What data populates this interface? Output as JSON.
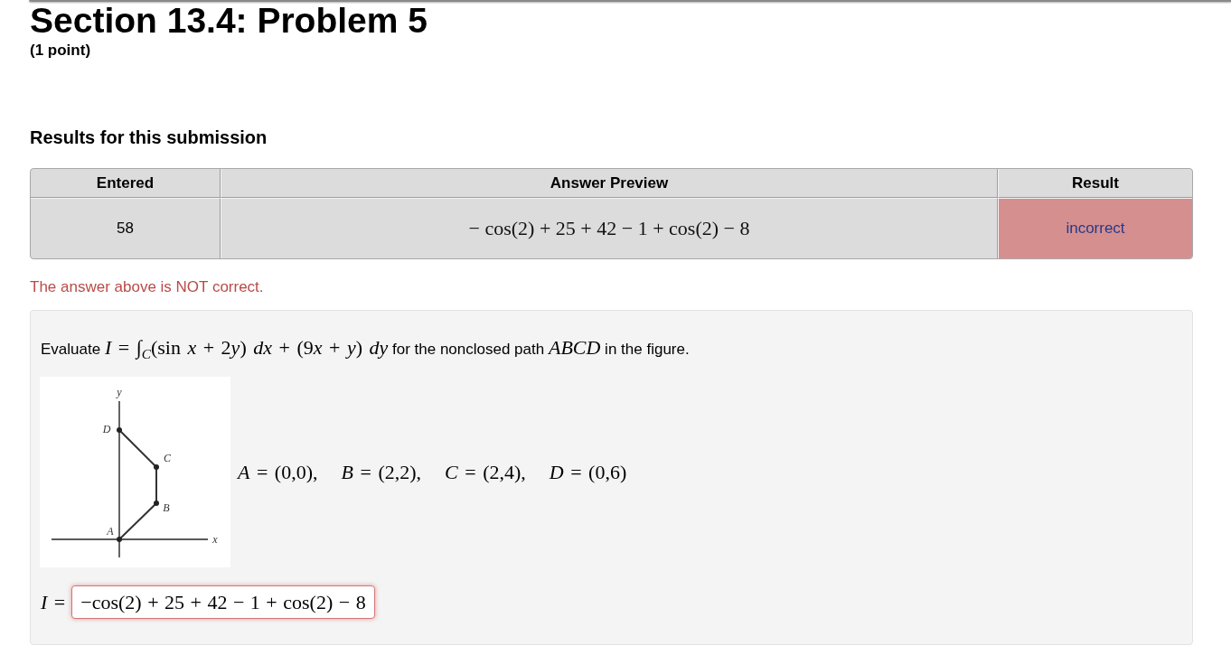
{
  "header": {
    "title": "Section 13.4: Problem 5",
    "points": "(1 point)"
  },
  "results": {
    "title": "Results for this submission",
    "columns": [
      {
        "label": "Entered",
        "kind": "text"
      },
      {
        "label": "Answer Preview",
        "kind": "math"
      },
      {
        "label": "Result",
        "kind": "status"
      }
    ],
    "rows": [
      {
        "cells": [
          "58",
          "− cos(2) + 25 + 42 − 1 + cos(2) − 8",
          "incorrect"
        ],
        "correct": false
      }
    ]
  },
  "feedback": {
    "text": "The answer above is NOT correct.",
    "correct": false
  },
  "problem": {
    "statement": [
      {
        "kind": "text",
        "text": "Evaluate "
      },
      {
        "kind": "math",
        "text": "*I* = ∫$_{C}$(sin *x* + 2"
      },
      {
        "kind": "math",
        "text": "*y*) *dx* + (9"
      },
      {
        "kind": "math",
        "text": "*x* + *y*) *dy*"
      },
      {
        "kind": "text",
        "text": " for the nonclosed path "
      },
      {
        "kind": "math",
        "text": "*ABCD*"
      },
      {
        "kind": "text",
        "text": " in the figure."
      }
    ],
    "figure": {
      "axis_labels": [
        "x",
        "y"
      ],
      "point_labels": [
        "A",
        "B",
        "C",
        "D"
      ]
    },
    "coordinates": [
      "*A* = (0,0),",
      "*B* = (2,2),",
      "*C* = (2,4),",
      "*D* = (0,6)"
    ],
    "answer": {
      "label": "*I* =",
      "value": "−cos(2) + 25 + 42 − 1 + cos(2) − 8",
      "correct": false
    }
  }
}
